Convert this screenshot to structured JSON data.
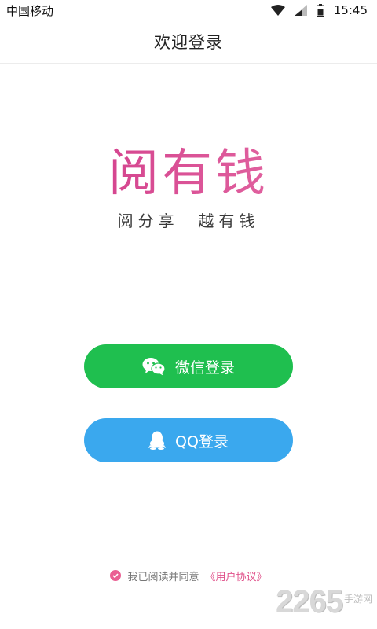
{
  "status_bar": {
    "carrier": "中国移动",
    "time": "15:45"
  },
  "header": {
    "title": "欢迎登录"
  },
  "logo": {
    "text": "阅有钱",
    "slogan": "阅分享  越有钱",
    "color": "#d84b92"
  },
  "buttons": {
    "wechat": {
      "label": "微信登录",
      "icon": "wechat-icon",
      "color": "#1fbf4f"
    },
    "qq": {
      "label": "QQ登录",
      "icon": "qq-penguin-icon",
      "color": "#3aa8ee"
    }
  },
  "agreement": {
    "text": "我已阅读并同意",
    "link": "《用户协议》",
    "checked": true
  },
  "watermark": {
    "number": "2265",
    "site": "手游网"
  }
}
